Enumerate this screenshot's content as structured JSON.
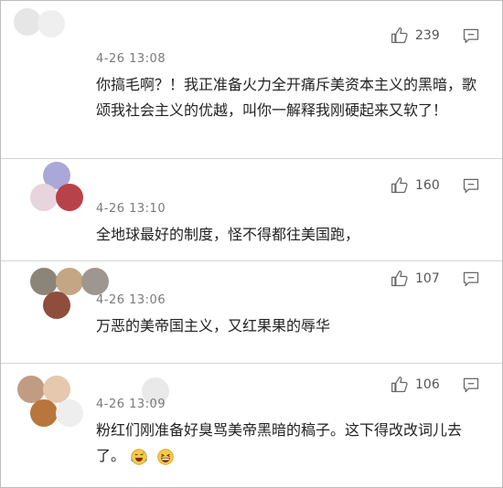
{
  "comments": [
    {
      "time": "4-26 13:08",
      "likes": "239",
      "text": "你搞毛啊？！我正准备火力全开痛斥美资本主义的黑暗，歌颂我社会主义的优越，叫你一解释我刚硬起来又软了！",
      "avatar_colors": [
        "#e3e3e3",
        "#eeeeee"
      ]
    },
    {
      "time": "4-26 13:10",
      "likes": "160",
      "text": "全地球最好的制度，怪不得都往美国跑，",
      "avatar_colors": [
        "#a9a8d8",
        "#e7d4dc",
        "#b8424a"
      ]
    },
    {
      "time": "4-26 13:06",
      "likes": "107",
      "text": "万恶的美帝国主义，又红果果的辱华",
      "avatar_colors": [
        "#8b8479",
        "#c4a684",
        "#9e9690",
        "#8f4d3c"
      ]
    },
    {
      "time": "4-26 13:09",
      "likes": "106",
      "text": "粉红们刚准备好臭骂美帝黑暗的稿子。这下得改改词儿去了。",
      "avatar_colors": [
        "#c29b83",
        "#e6c8ae",
        "#b8763c",
        "#eeeeee"
      ]
    }
  ],
  "icons": {
    "like": "thumbs-up-icon",
    "reply": "comment-icon"
  },
  "emojis": [
    "sweat-laugh-emoji",
    "grin-emoji"
  ]
}
